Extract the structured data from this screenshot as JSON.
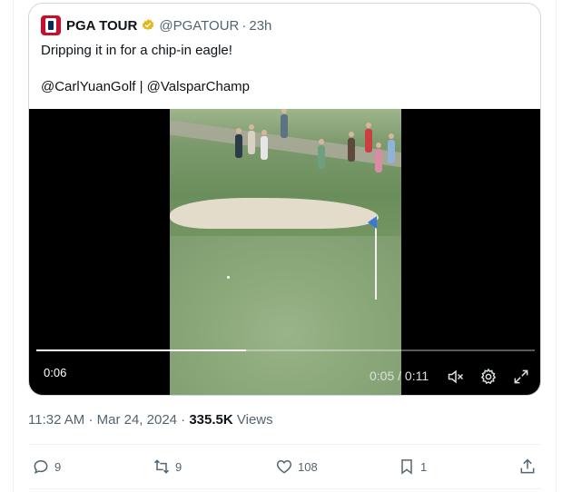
{
  "quote": {
    "account_name": "PGA TOUR",
    "handle": "@PGATOUR",
    "separator": "·",
    "age": "23h",
    "text": "Dripping it in for a chip-in eagle!",
    "mentions": "@CarlYuanGolf | @ValsparChamp"
  },
  "video": {
    "elapsed_badge": "0:06",
    "position": "0:05",
    "duration": "0:11",
    "progress_fraction": 0.42
  },
  "meta": {
    "time": "11:32 AM",
    "sep1": "·",
    "date": "Mar 24, 2024",
    "sep2": "·",
    "views_count": "335.5K",
    "views_label": "Views"
  },
  "actions": {
    "replies": "9",
    "reposts": "9",
    "likes": "108",
    "bookmarks": "1"
  },
  "colors": {
    "verified_badge": "#e2b719",
    "text_primary": "#0f1419",
    "text_secondary": "#536471",
    "border": "#cfd9de"
  }
}
